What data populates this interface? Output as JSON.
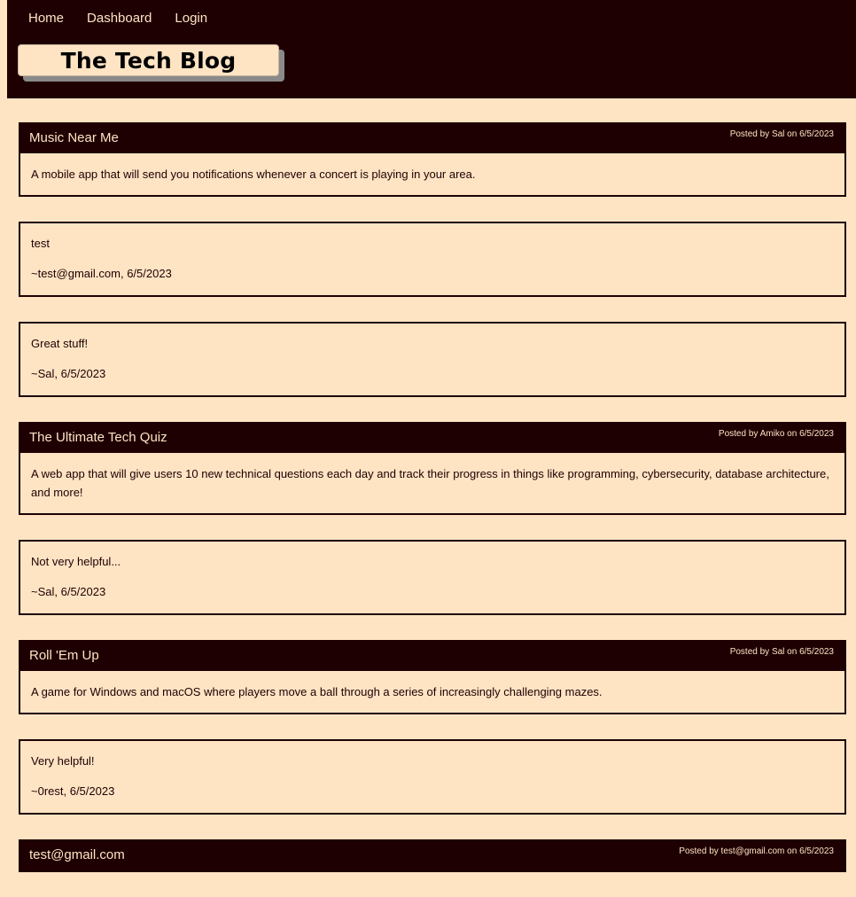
{
  "nav": {
    "home": "Home",
    "dashboard": "Dashboard",
    "login": "Login"
  },
  "site_title": "The Tech Blog",
  "posts": [
    {
      "title": "Music Near Me",
      "meta": "Posted by Sal on 6/5/2023",
      "body": "A mobile app that will send you notifications whenever a concert is playing in your area.",
      "comments": [
        {
          "text": "test",
          "by": "~test@gmail.com, 6/5/2023"
        },
        {
          "text": "Great stuff!",
          "by": "~Sal, 6/5/2023"
        }
      ]
    },
    {
      "title": "The Ultimate Tech Quiz",
      "meta": "Posted by Amiko on 6/5/2023",
      "body": "A web app that will give users 10 new technical questions each day and track their progress in things like programming, cybersecurity, database architecture, and more!",
      "comments": [
        {
          "text": "Not very helpful...",
          "by": "~Sal, 6/5/2023"
        }
      ]
    },
    {
      "title": "Roll 'Em Up",
      "meta": "Posted by Sal on 6/5/2023",
      "body": "A game for Windows and macOS where players move a ball through a series of increasingly challenging mazes.",
      "comments": [
        {
          "text": "Very helpful!",
          "by": "~0rest, 6/5/2023"
        }
      ]
    },
    {
      "title": "test@gmail.com",
      "meta": "Posted by test@gmail.com on 6/5/2023",
      "body": "",
      "comments": []
    }
  ]
}
